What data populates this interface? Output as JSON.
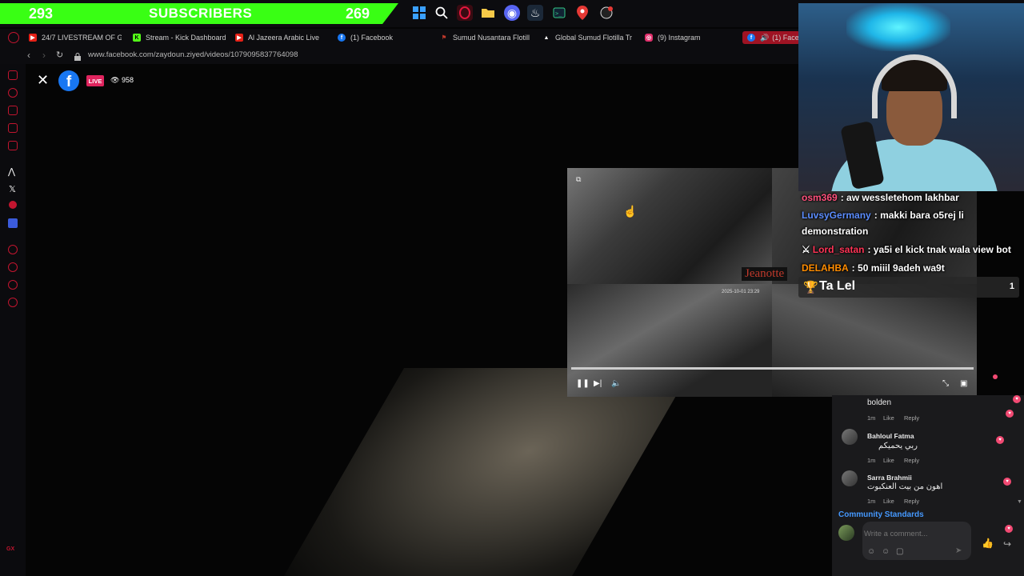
{
  "banner": {
    "left_count": "293",
    "title": "SUBSCRIBERS",
    "right_count": "269"
  },
  "taskbar": {
    "icons": [
      "windows-icon",
      "search-icon",
      "opera-gx-icon",
      "folder-icon",
      "discord-icon",
      "steam-icon",
      "terminal-icon",
      "maps-icon",
      "obs-icon"
    ]
  },
  "tabs": [
    {
      "label": "24/7 LIVESTREAM OF GL",
      "icon": "youtube-icon",
      "color": "#e62117"
    },
    {
      "label": "Stream - Kick Dashboard",
      "icon": "kick-icon",
      "color": "#53fc18"
    },
    {
      "label": "Al Jazeera Arabic Live",
      "icon": "youtube-icon",
      "color": "#e62117"
    },
    {
      "label": "(1) Facebook",
      "icon": "facebook-icon",
      "color": "#1877f2"
    },
    {
      "label": "Sumud Nusantara Flotilla",
      "icon": "flag-icon",
      "color": "#c0392b"
    },
    {
      "label": "Global Sumud Flotilla Tra",
      "icon": "triangle-icon",
      "color": "#ffffff"
    },
    {
      "label": "(9) Instagram",
      "icon": "instagram-icon",
      "color": "#e1306c"
    },
    {
      "label": "(1) Faceb",
      "icon": "facebook-icon",
      "color": "#1877f2"
    }
  ],
  "address": {
    "url": "www.facebook.com/zaydoun.ziyed/videos/1079095837764098"
  },
  "player": {
    "live": "LIVE",
    "viewers": "958"
  },
  "mini_player": {
    "cam_name": "Jeanotte",
    "cam_date": "2025-10-01 23:29",
    "progress": 1.0
  },
  "chat": [
    {
      "user": "osm369",
      "user_color": "#ff4f7b",
      "message": "aw wessletehom lakhbar"
    },
    {
      "user": "LuvsyGermany",
      "user_color": "#5b8dff",
      "message": "makki bara o5rej li"
    },
    {
      "user": "",
      "user_color": "#ffffff",
      "message": "demonstration"
    },
    {
      "user": "Lord_satan",
      "user_color": "#ff3355",
      "message": "ya5i el kick tnak wala view bot"
    },
    {
      "user": "DELAHBA",
      "user_color": "#ff8c00",
      "message": "50 miiil 9adeh wa9t"
    }
  ],
  "trophy": {
    "name": "Ta Lel",
    "count": "1"
  },
  "comments": [
    {
      "name": "",
      "text": "bolden",
      "time": "1m",
      "like": "Like",
      "reply": "Reply"
    },
    {
      "name": "Bahloul Fatma",
      "text": "ربي يحميكم",
      "time": "1m",
      "like": "Like",
      "reply": "Reply"
    },
    {
      "name": "Sarra Brahmii",
      "text": "اهون من بيت العنكبوت",
      "time": "1m",
      "like": "Like",
      "reply": "Reply"
    }
  ],
  "community_standards": "Community Standards",
  "comment_placeholder": "Write a comment...",
  "colors": {
    "accent": "#c2152f",
    "banner": "#39ff14",
    "facebook": "#1877f2",
    "live": "#e0245e"
  }
}
